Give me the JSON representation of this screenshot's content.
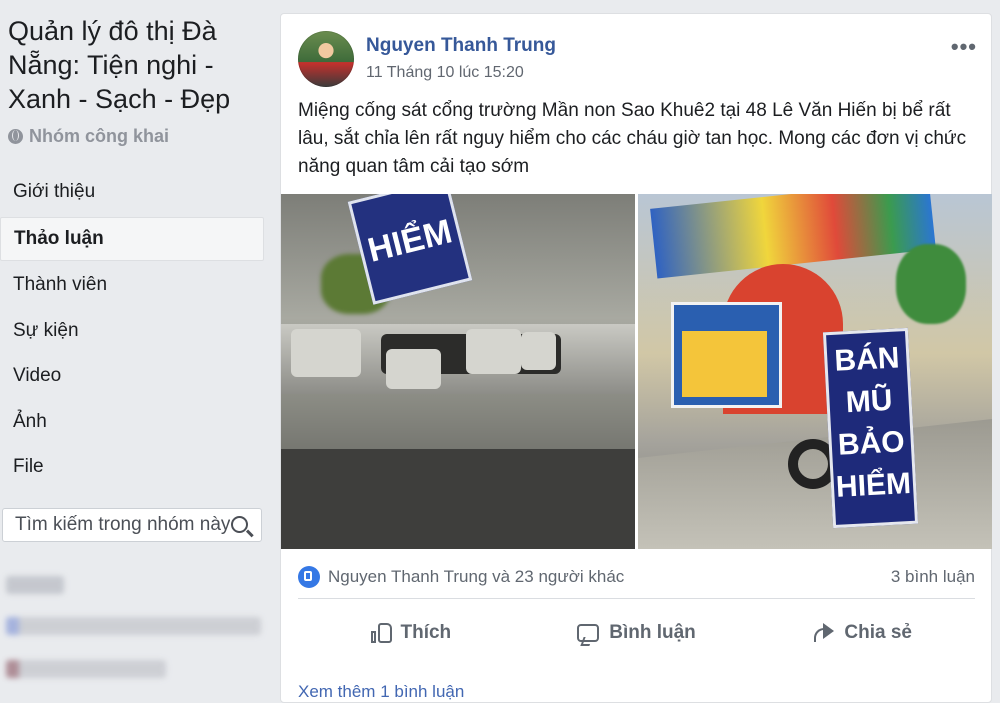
{
  "sidebar": {
    "group_title": "Quản lý đô thị Đà Nẵng: Tiện nghi - Xanh - Sạch - Đẹp",
    "privacy_label": "Nhóm công khai",
    "privacy_icon": "globe-icon",
    "nav_items": [
      {
        "label": "Giới thiệu",
        "active": false
      },
      {
        "label": "Thảo luận",
        "active": true
      },
      {
        "label": "Thành viên",
        "active": false
      },
      {
        "label": "Sự kiện",
        "active": false
      },
      {
        "label": "Video",
        "active": false
      },
      {
        "label": "Ảnh",
        "active": false
      },
      {
        "label": "File",
        "active": false
      }
    ],
    "search_placeholder": "Tìm kiếm trong nhóm này",
    "search_icon": "search-icon"
  },
  "post": {
    "author": "Nguyen Thanh Trung",
    "timestamp": "11 Tháng 10 lúc 15:20",
    "more_icon": "more-icon",
    "more_glyph": "•••",
    "text": "Miệng cống sát cổng trường Mần non Sao Khuê2 tại 48 Lê Văn Hiến bị bể rất lâu, sắt chỉa lên rất nguy hiểm cho các cháu giờ tan học. Mong các đơn vị chức năng quan tâm cải tạo sớm",
    "photos": {
      "left_sign_text": "HIỂM",
      "right_sign_lines": [
        "BÁN",
        "MŨ",
        "BẢO",
        "HIỂM"
      ]
    },
    "reactions": {
      "icon": "like-badge-icon",
      "summary": "Nguyen Thanh Trung và 23 người khác",
      "comment_count": "3 bình luận"
    },
    "actions": {
      "like": "Thích",
      "comment": "Bình luận",
      "share": "Chia sẻ"
    },
    "more_comments": "Xem thêm 1 bình luận"
  },
  "colors": {
    "background": "#e9ebee",
    "link_blue": "#365899",
    "like_blue": "#3578e5",
    "muted_text": "#606770"
  }
}
